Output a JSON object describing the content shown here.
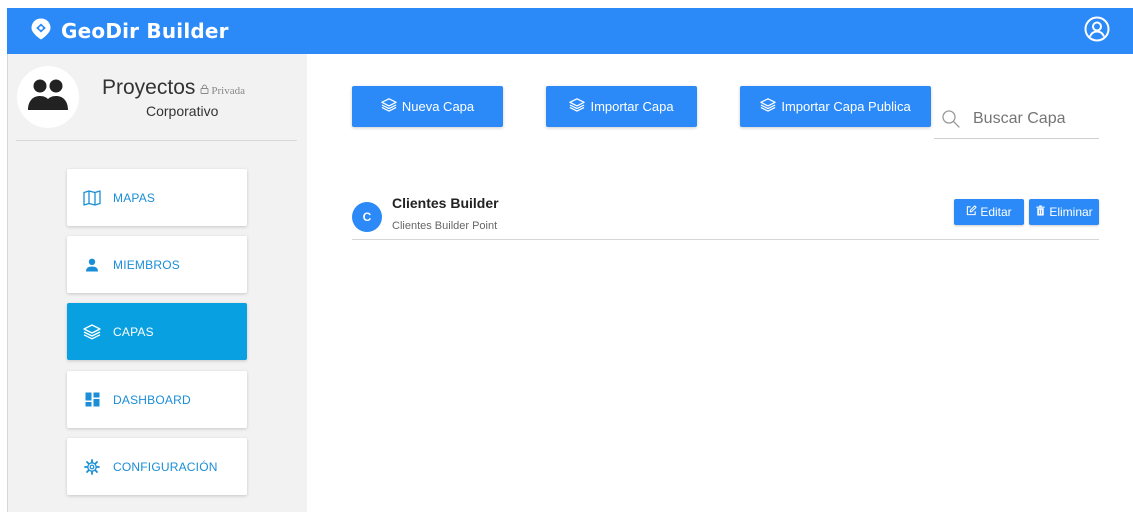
{
  "header": {
    "brand": "GeoDir Builder",
    "brand_icon": "map-pin-logo-icon",
    "user_icon": "user-circle-icon"
  },
  "project": {
    "title": "Proyectos",
    "privacy": "Privada",
    "subtitle": "Corporativo"
  },
  "sidebar": {
    "items": [
      {
        "label": "MAPAS",
        "icon": "map-icon",
        "active": false
      },
      {
        "label": "MIEMBROS",
        "icon": "person-icon",
        "active": false
      },
      {
        "label": "CAPAS",
        "icon": "layers-icon",
        "active": true
      },
      {
        "label": "DASHBOARD",
        "icon": "dashboard-icon",
        "active": false
      },
      {
        "label": "CONFIGURACIÓN",
        "icon": "gear-icon",
        "active": false
      }
    ]
  },
  "toolbar": {
    "new_layer": "Nueva Capa",
    "import_layer": "Importar Capa",
    "import_public_layer": "Importar Capa Publica"
  },
  "search": {
    "placeholder": "Buscar Capa",
    "value": ""
  },
  "layers": [
    {
      "initial": "C",
      "title": "Clientes Builder",
      "description": "Clientes Builder Point",
      "edit_label": "Editar",
      "delete_label": "Eliminar"
    }
  ],
  "colors": {
    "primary": "#2b8af7",
    "active_nav": "#08a0e0",
    "nav_text": "#1a8ed6",
    "sidebar_bg": "#f2f2f2"
  }
}
